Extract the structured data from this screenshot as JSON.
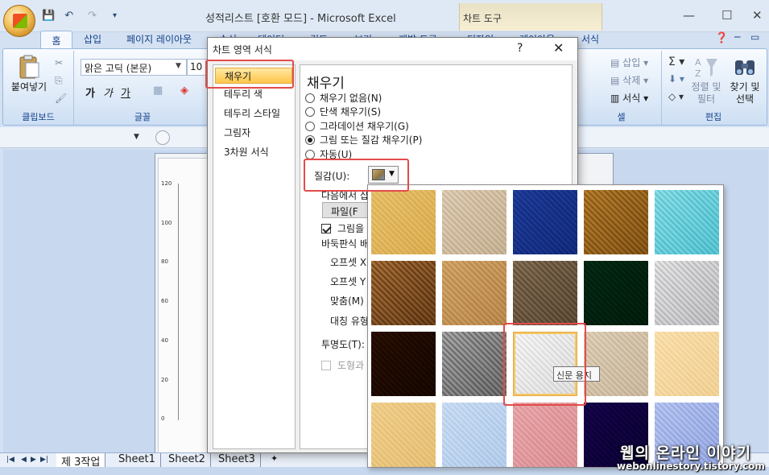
{
  "window": {
    "title": "성적리스트  [호환 모드] - Microsoft Excel",
    "context_tab_group": "차트 도구",
    "minimize": "—",
    "maximize": "☐",
    "close": "✕"
  },
  "qat": {
    "save": "💾",
    "undo": "↶",
    "redo": "↷",
    "customize": "▾"
  },
  "ribbon_tabs": [
    "홈",
    "삽입",
    "페이지 레이아웃",
    "수식",
    "데이터",
    "검토",
    "보기",
    "개발 도구",
    "디자인",
    "레이아웃",
    "서식"
  ],
  "ribbon": {
    "clipboard": {
      "label": "클립보드",
      "paste": "붙여넣기"
    },
    "font": {
      "label": "글꼴",
      "font_name": "맑은 고딕 (본문)",
      "font_size": "10",
      "bold": "가",
      "italic": "가",
      "underline": "가"
    },
    "cells": {
      "label": "셀",
      "insert": "삽입",
      "delete": "삭제",
      "format": "서식"
    },
    "editing": {
      "label": "편집",
      "sort_filter": "정렬 및\n필터",
      "find_select": "찾기 및\n선택",
      "sort_line1": "정렬 및",
      "sort_line2": "필터",
      "find_line1": "찾기 및",
      "find_line2": "선택"
    }
  },
  "chart": {
    "y_ticks": [
      "120",
      "100",
      "80",
      "60",
      "40",
      "20",
      "0"
    ]
  },
  "sheet_tabs": [
    "제 3작업",
    "Sheet1",
    "Sheet2",
    "Sheet3"
  ],
  "dialog": {
    "title": "차트 영역 서식",
    "help": "?",
    "close": "✕",
    "categories": [
      "채우기",
      "테두리 색",
      "테두리 스타일",
      "그림자",
      "3차원 서식"
    ],
    "selected_category": "채우기",
    "panel": {
      "heading": "채우기",
      "options": [
        {
          "label": "채우기 없음(N)",
          "selected": false
        },
        {
          "label": "단색 채우기(S)",
          "selected": false
        },
        {
          "label": "그라데이션 채우기(G)",
          "selected": false
        },
        {
          "label": "그림 또는 질감 채우기(P)",
          "selected": true
        },
        {
          "label": "자동(U)",
          "selected": false
        }
      ],
      "texture_label": "질감(U):",
      "insert_from_label": "다음에서 삽",
      "file_button": "파일(F",
      "tile_checkbox": "그림을",
      "tile_checked": true,
      "tiling_options_label": "바둑판식 배",
      "offset_x_label": "오프셋 X",
      "offset_y_label": "오프셋 Y",
      "alignment_label": "맞춤(M)",
      "mirror_label": "대칭 유형",
      "transparency_label": "투명도(T):",
      "rotate_checkbox": "도형과",
      "rotate_checked": false
    }
  },
  "texture_gallery": {
    "hovered_index": 12,
    "tooltip": "신문 용지",
    "textures": [
      {
        "name": "papyrus",
        "colors": [
          "#f3dfa8",
          "#e9cc86"
        ]
      },
      {
        "name": "canvas",
        "colors": [
          "#efe6d8",
          "#d9ccb8"
        ]
      },
      {
        "name": "denim",
        "colors": [
          "#5a7fc8",
          "#3d5fa8"
        ]
      },
      {
        "name": "woven-mat",
        "colors": [
          "#d8b46c",
          "#a6823d"
        ]
      },
      {
        "name": "water-droplets",
        "colors": [
          "#bfeef2",
          "#7fd6e0"
        ]
      },
      {
        "name": "paper-bag",
        "colors": [
          "#cfa978",
          "#8e6a3e"
        ]
      },
      {
        "name": "fish-fossil",
        "colors": [
          "#e8cfa5",
          "#d2b081"
        ]
      },
      {
        "name": "sand",
        "colors": [
          "#b8a993",
          "#8a7a66"
        ]
      },
      {
        "name": "green-marble",
        "colors": [
          "#1f6b48",
          "#0f4a30"
        ]
      },
      {
        "name": "white-marble",
        "colors": [
          "#f2f2f2",
          "#cfcfd2"
        ]
      },
      {
        "name": "brown-marble",
        "colors": [
          "#6b3f19",
          "#3e220b"
        ]
      },
      {
        "name": "granite",
        "colors": [
          "#cfcfcf",
          "#8f8f8f"
        ]
      },
      {
        "name": "newsprint",
        "colors": [
          "#fbfbfb",
          "#e6e6e6"
        ]
      },
      {
        "name": "recycled-paper",
        "colors": [
          "#efe7da",
          "#dcd1bf"
        ]
      },
      {
        "name": "parchment",
        "colors": [
          "#fdf0d4",
          "#f5e2bb"
        ]
      },
      {
        "name": "stationery",
        "colors": [
          "#f8e7c0",
          "#efd8a4"
        ]
      },
      {
        "name": "blue-tissue-paper",
        "colors": [
          "#e4eef9",
          "#cfdff2"
        ]
      },
      {
        "name": "pink-tissue-paper",
        "colors": [
          "#f4d1d3",
          "#e9b8bc"
        ]
      },
      {
        "name": "purple-mesh",
        "colors": [
          "#4b1f8f",
          "#2c0f63"
        ]
      },
      {
        "name": "bouquet",
        "colors": [
          "#d9e1f7",
          "#b9c6ec"
        ]
      }
    ]
  },
  "watermark": {
    "line1": "웹의 온라인 이야기",
    "line2": "webonlinestory.tistory.com"
  }
}
